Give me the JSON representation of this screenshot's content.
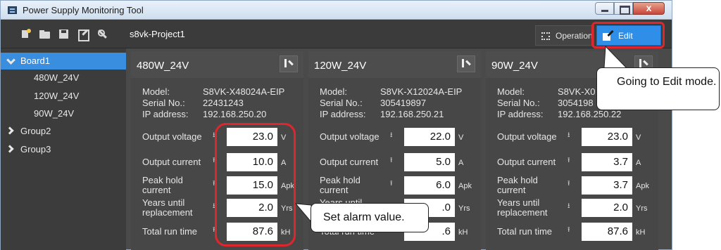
{
  "window": {
    "title": "Power Supply Monitoring Tool",
    "controls": {
      "min": "",
      "max": "",
      "close": "x"
    }
  },
  "toolbar": {
    "project_name": "s8vk-Project1",
    "icons": [
      "new-project-icon",
      "open-folder-icon",
      "save-icon",
      "edit-list-icon",
      "wrench-icon"
    ],
    "operation_label": "Operation",
    "edit_label": "Edit",
    "edit_color": "#2f8fe8"
  },
  "tree": {
    "items": [
      {
        "label": "Board1",
        "expanded": true,
        "selected": true
      },
      {
        "label": "480W_24V"
      },
      {
        "label": "120W_24V"
      },
      {
        "label": "90W_24V"
      },
      {
        "label": "Group2",
        "expanded": false
      },
      {
        "label": "Group3",
        "expanded": false
      }
    ]
  },
  "labels": {
    "model": "Model:",
    "serial": "Serial No.:",
    "ip": "IP address:",
    "output_voltage": "Output voltage",
    "output_current": "Output current",
    "peak_hold": "Peak hold current",
    "years_until": "Years until replacement",
    "total_run": "Total run time"
  },
  "panels": [
    {
      "title": "480W_24V",
      "model": "S8VK-X48024A-EIP",
      "serial": "22431243",
      "ip": "192.168.250.20",
      "output_voltage": "23.0",
      "output_voltage_unit": "V",
      "output_current": "10.0",
      "output_current_unit": "A",
      "peak_hold": "15.0",
      "peak_hold_unit": "Apk",
      "years_until": "2.0",
      "years_until_unit": "Yrs",
      "total_run": "87.6",
      "total_run_unit": "kH"
    },
    {
      "title": "120W_24V",
      "model": "S8VK-X12024A-EIP",
      "serial": "305419897",
      "ip": "192.168.250.21",
      "output_voltage": "22.0",
      "output_voltage_unit": "V",
      "output_current": "5.0",
      "output_current_unit": "A",
      "peak_hold": "6.0",
      "peak_hold_unit": "Apk",
      "years_until": ".0",
      "years_until_unit": "Yrs",
      "total_run": ".6",
      "total_run_unit": "kH"
    },
    {
      "title": "90W_24V",
      "model": "S8VK-X0",
      "serial": "3054198",
      "ip": "192.168.250.22",
      "output_voltage": "23.0",
      "output_voltage_unit": "V",
      "output_current": "3.7",
      "output_current_unit": "A",
      "peak_hold": "3.7",
      "peak_hold_unit": "Apk",
      "years_until": "2.0",
      "years_until_unit": "Yrs",
      "total_run": "87.6",
      "total_run_unit": "kH"
    }
  ],
  "callouts": {
    "edit_mode": "Going to Edit mode.",
    "set_alarm": "Set alarm value."
  },
  "accent_colors": {
    "highlight_red": "#e0262d",
    "selection_blue": "#3a8ee0"
  }
}
